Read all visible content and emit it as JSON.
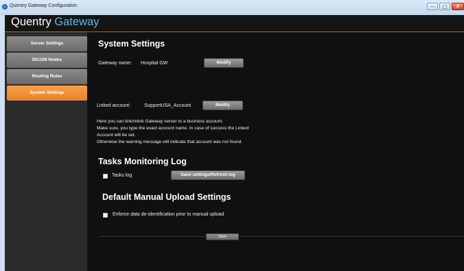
{
  "window": {
    "title": "Quentry Gateway Configuration",
    "min_glyph": "—",
    "max_glyph": "□",
    "close_glyph": "✕"
  },
  "brand": {
    "part1": "Quentry",
    "part2": "Gateway"
  },
  "colors": {
    "accent_orange": "#e98a2f",
    "brand_blue": "#5bb7e6",
    "nav_gray": "#7c7c7c",
    "background": "#101010"
  },
  "sidebar": {
    "items": [
      {
        "label": "Server Settings",
        "active": false
      },
      {
        "label": "DICOM Nodes",
        "active": false
      },
      {
        "label": "Routing Rules",
        "active": false
      },
      {
        "label": "System Settings",
        "active": true
      }
    ]
  },
  "system_settings": {
    "title": "System Settings",
    "gateway_name_label": "Gateway name:",
    "gateway_name_value": "Hospital GW",
    "modify_label": "Modify",
    "linked_account_label": "Linked account:",
    "linked_account_value": "SupportUSA_Account",
    "modify2_label": "Modify",
    "description": [
      "Here you can link/relink Gateway server to a business account.",
      "Make sure, you type the exact account name. In case of success the Linked",
      "Account will be set.",
      "Otherwise the warning message will indicate that account was not found."
    ]
  },
  "tasks_log": {
    "title": "Tasks Monitoring Log",
    "checkbox_label": "Tasks log",
    "checked": false,
    "button_label": "Save settings/Refresh log"
  },
  "upload": {
    "title": "Default Manual Upload Settings",
    "checkbox_label": "Enforce data de-identification prior to manual upload",
    "checked": false
  },
  "footer": {
    "save_label": "Save"
  }
}
